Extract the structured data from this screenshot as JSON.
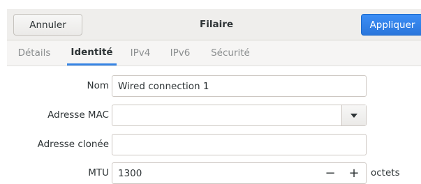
{
  "header": {
    "cancel_label": "Annuler",
    "title": "Filaire",
    "apply_label": "Appliquer"
  },
  "tabs": [
    {
      "label": "Détails",
      "active": false
    },
    {
      "label": "Identité",
      "active": true
    },
    {
      "label": "IPv4",
      "active": false
    },
    {
      "label": "IPv6",
      "active": false
    },
    {
      "label": "Sécurité",
      "active": false
    }
  ],
  "form": {
    "name_label": "Nom",
    "name_value": "Wired connection 1",
    "mac_label": "Adresse MAC",
    "mac_value": "",
    "cloned_label": "Adresse clonée",
    "cloned_value": "",
    "mtu_label": "MTU",
    "mtu_value": "1300",
    "mtu_units": "octets",
    "mtu_minus": "−",
    "mtu_plus": "+"
  },
  "colors": {
    "accent": "#3584e4",
    "apply_bg": "#3584e4"
  },
  "icons": {
    "mac_dropdown": "pan-down-icon"
  }
}
